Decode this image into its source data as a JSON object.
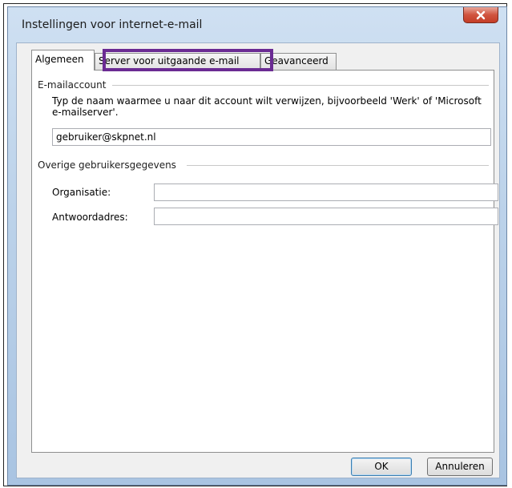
{
  "window": {
    "title": "Instellingen voor internet-e-mail"
  },
  "tabs": [
    {
      "label": "Algemeen"
    },
    {
      "label": "Server voor uitgaande e-mail"
    },
    {
      "label": "Geavanceerd"
    }
  ],
  "email_account": {
    "group_label": "E-mailaccount",
    "description": "Typ de naam waarmee u naar dit account wilt verwijzen, bijvoorbeeld 'Werk' of 'Microsoft e-mailserver'.",
    "account_name_value": "gebruiker@skpnet.nl"
  },
  "other_info": {
    "group_label": "Overige gebruikersgegevens",
    "organization_label": "Organisatie:",
    "organization_value": "",
    "reply_label": "Antwoordadres:",
    "reply_value": ""
  },
  "buttons": {
    "ok": "OK",
    "cancel": "Annuleren"
  },
  "colors": {
    "highlight": "#6b2b93",
    "close_button": "#c43d27"
  },
  "icons": {
    "close": "close-icon"
  }
}
